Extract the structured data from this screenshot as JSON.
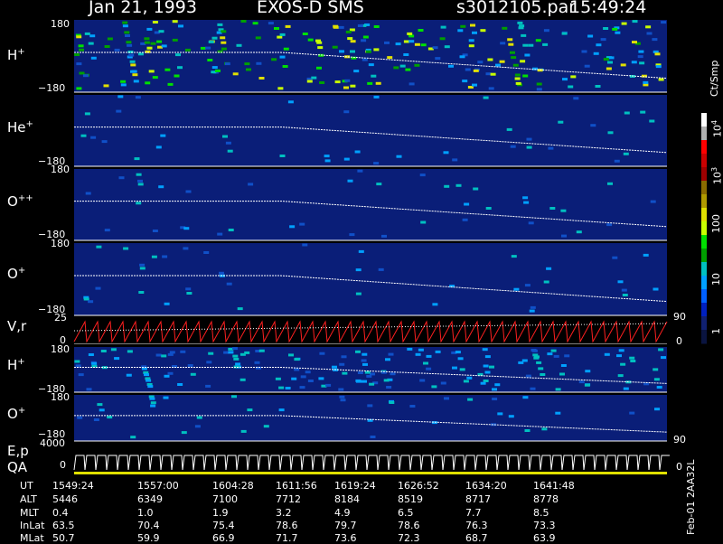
{
  "header": {
    "date": "Jan 21, 1993",
    "instrument": "EXOS-D SMS",
    "file": "s3012105.par",
    "time": "15:49:24"
  },
  "panels": [
    {
      "label": "H",
      "sup": "+",
      "ymax": "180",
      "ymin": "−180"
    },
    {
      "label": "He",
      "sup": "+",
      "ymax": "",
      "ymin": "−180"
    },
    {
      "label": "O",
      "sup": "++",
      "ymax": "180",
      "ymin": "−180"
    },
    {
      "label": "O",
      "sup": "+",
      "ymax": "180",
      "ymin": "−180"
    },
    {
      "label": "V,r",
      "sup": "",
      "ymax": "25",
      "ymin": "0",
      "right_max": "90",
      "right_min": "0"
    },
    {
      "label": "H",
      "sup": "+",
      "ymax": "180",
      "ymin": "−180"
    },
    {
      "label": "O",
      "sup": "+",
      "ymax": "180",
      "ymin": "−180"
    },
    {
      "label": "E,p",
      "label2": "QA",
      "sup": "",
      "ymax": "4000",
      "ymin": "0",
      "right_max": "90",
      "right_min": "0"
    }
  ],
  "colorbar": {
    "unit": "Ct/Smp",
    "ticks": [
      "10",
      "10",
      "100",
      "10",
      "1"
    ],
    "tick_sups": [
      "4",
      "3",
      "",
      "",
      ""
    ],
    "colors": [
      "#ffffff",
      "#b0b0b0",
      "#ff0000",
      "#cc0000",
      "#a00000",
      "#8b6b00",
      "#b09a00",
      "#e0e000",
      "#c8ff00",
      "#00e000",
      "#00a000",
      "#00c0c0",
      "#00a0ff",
      "#0060ff",
      "#0020c0",
      "#102070",
      "#0a1440"
    ]
  },
  "table": {
    "rows": [
      {
        "name": "UT",
        "values": [
          "1549:24",
          "1557:00",
          "1604:28",
          "1611:56",
          "1619:24",
          "1626:52",
          "1634:20",
          "1641:48"
        ]
      },
      {
        "name": "ALT",
        "values": [
          "5446",
          "6349",
          "7100",
          "7712",
          "8184",
          "8519",
          "8717",
          "8778"
        ]
      },
      {
        "name": "MLT",
        "values": [
          "0.4",
          "1.0",
          "1.9",
          "3.2",
          "4.9",
          "6.5",
          "7.7",
          "8.5"
        ]
      },
      {
        "name": "InLat",
        "values": [
          "63.5",
          "70.4",
          "75.4",
          "78.6",
          "79.7",
          "78.6",
          "76.3",
          "73.3"
        ]
      },
      {
        "name": "MLat",
        "values": [
          "50.7",
          "59.9",
          "66.9",
          "71.7",
          "73.6",
          "72.3",
          "68.7",
          "63.9"
        ]
      }
    ]
  },
  "footer_code": "Feb-01 2AA32L",
  "colors": {
    "background": "#000000",
    "fill": "#0a1e78",
    "trace": "#ffffff",
    "velocity": "#ff2020"
  },
  "chart_data": {
    "type": "heatmap",
    "title": "Jan 21, 1993   EXOS-D SMS",
    "x": [
      "1549:24",
      "1557:00",
      "1604:28",
      "1611:56",
      "1619:24",
      "1626:52",
      "1634:20",
      "1641:48"
    ],
    "series": [
      {
        "name": "H+",
        "ylim": [
          -180,
          180
        ]
      },
      {
        "name": "He+",
        "ylim": [
          -180,
          180
        ]
      },
      {
        "name": "O++",
        "ylim": [
          -180,
          180
        ]
      },
      {
        "name": "O+",
        "ylim": [
          -180,
          180
        ]
      },
      {
        "name": "V,r",
        "ylim": [
          0,
          25
        ]
      },
      {
        "name": "H+",
        "ylim": [
          -180,
          180
        ]
      },
      {
        "name": "O+",
        "ylim": [
          -180,
          180
        ]
      },
      {
        "name": "E,p",
        "ylim": [
          0,
          4000
        ]
      }
    ],
    "colorscale": "log",
    "colorbar_label": "Ct/Smp",
    "colorbar_range": [
      1,
      10000
    ]
  }
}
